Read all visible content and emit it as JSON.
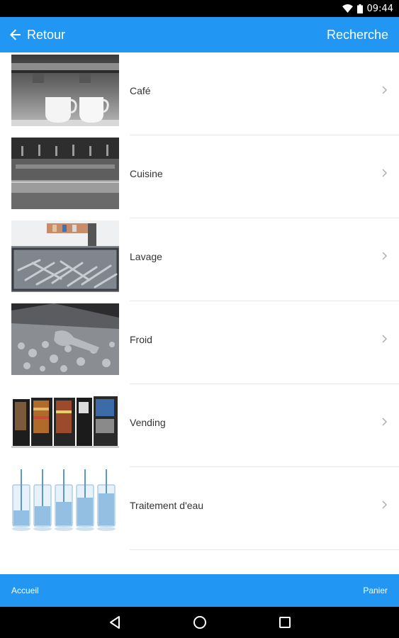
{
  "status_bar": {
    "time": "09:44",
    "icons": [
      "wifi-icon",
      "battery-icon"
    ]
  },
  "app_bar": {
    "back_label": "Retour",
    "search_label": "Recherche",
    "color": "#2196f3"
  },
  "list": {
    "items": [
      {
        "label": "Café",
        "image": "coffee-cups-image"
      },
      {
        "label": "Cuisine",
        "image": "kitchen-image"
      },
      {
        "label": "Lavage",
        "image": "dishwashing-image"
      },
      {
        "label": "Froid",
        "image": "ice-image"
      },
      {
        "label": "Vending",
        "image": "vending-machines-image"
      },
      {
        "label": "Traitement d'eau",
        "image": "water-glasses-image"
      }
    ]
  },
  "bottom_bar": {
    "left_label": "Accueil",
    "right_label": "Panier"
  },
  "nav_bar": {
    "icons": [
      "back-triangle-icon",
      "home-circle-icon",
      "recents-square-icon"
    ]
  }
}
